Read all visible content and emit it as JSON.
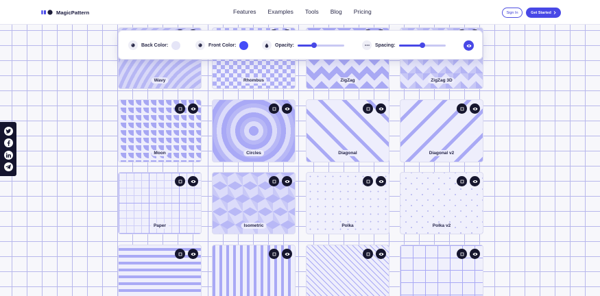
{
  "header": {
    "logo_text": "MagicPattern",
    "nav": [
      "Features",
      "Examples",
      "Tools",
      "Blog",
      "Pricing"
    ],
    "sign_in": "Sign In",
    "get_started": "Get Started"
  },
  "controls": {
    "back_color_label": "Back Color:",
    "front_color_label": "Front Color:",
    "opacity_label": "Opacity:",
    "spacing_label": "Spacing:",
    "back_color": "#e5e5f7",
    "front_color": "#444cf7",
    "opacity": 0.4,
    "spacing": 0.5
  },
  "cards": [
    "Wavy",
    "Rhombus",
    "ZigZag",
    "ZigZag 3D",
    "Moon",
    "Circles",
    "Diagonal",
    "Diagonal v2",
    "Paper",
    "Isometric",
    "Polka",
    "Polka v2"
  ],
  "social": [
    "twitter-icon",
    "facebook-icon",
    "linkedin-icon",
    "telegram-icon"
  ],
  "colors": {
    "accent": "#4848e6",
    "dark": "#16162e"
  }
}
